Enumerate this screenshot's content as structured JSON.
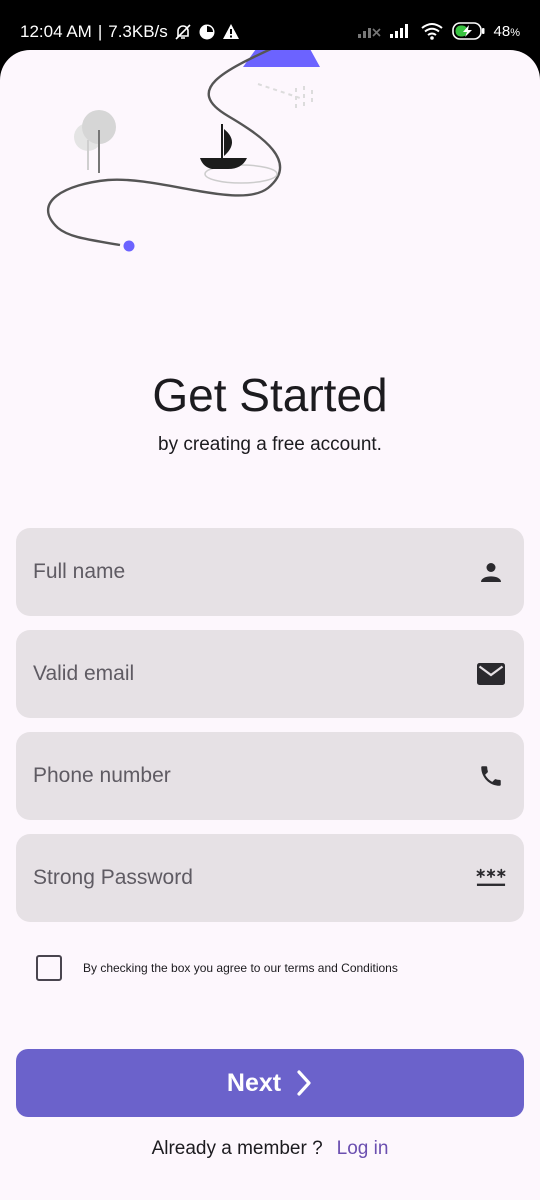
{
  "status_bar": {
    "time": "12:04 AM",
    "separator": "|",
    "speed": "7.3KB/s",
    "battery": "48",
    "battery_unit": "%",
    "icons": [
      "muted-bell-icon",
      "data-saver-icon",
      "warning-icon",
      "signal-icon",
      "signal-icon",
      "wifi-icon",
      "battery-charging-icon"
    ]
  },
  "header": {
    "title": "Get Started",
    "subtitle": "by creating a free account."
  },
  "form": {
    "full_name": {
      "placeholder": "Full name",
      "icon": "person-icon"
    },
    "email": {
      "placeholder": "Valid email",
      "icon": "mail-icon"
    },
    "phone": {
      "placeholder": "Phone number",
      "icon": "phone-icon"
    },
    "password": {
      "placeholder": "Strong Password",
      "icon": "password-icon"
    },
    "terms": {
      "checked": false,
      "label": "By checking the box you agree to our terms and Conditions"
    }
  },
  "actions": {
    "next_label": "Next",
    "member_question": "Already a member ?",
    "login_label": "Log in"
  },
  "colors": {
    "primary": "#6b62cb",
    "accent_illustration": "#6c63ff",
    "field_bg": "#e6e1e5",
    "screen_bg": "#fdf7fd",
    "link": "#6b4fb0"
  }
}
